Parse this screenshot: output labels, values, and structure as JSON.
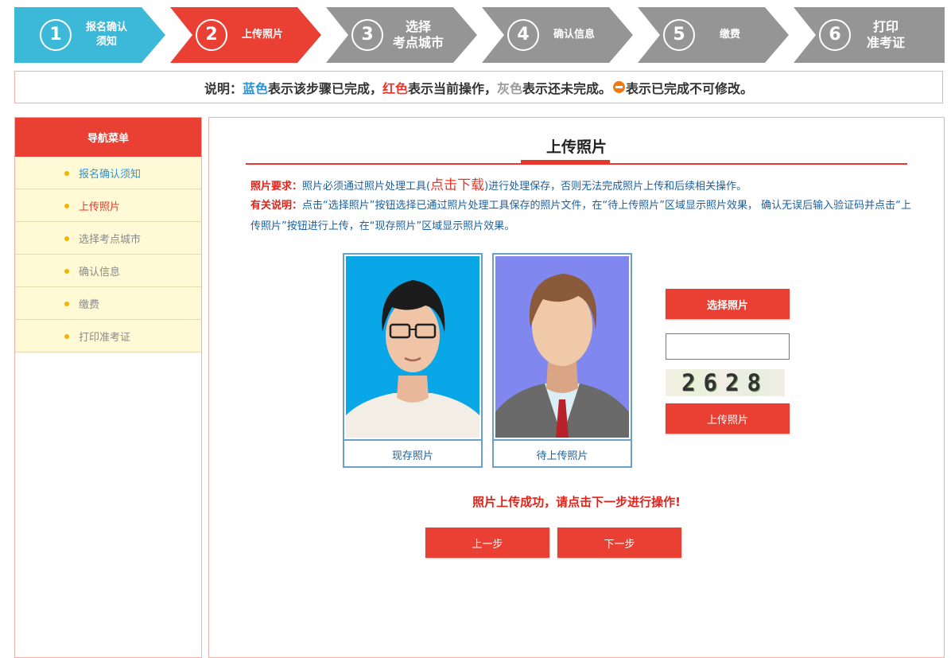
{
  "steps": [
    {
      "num": "1",
      "label": "报名确认\n须知",
      "status": "done",
      "color": "#3cb8d8"
    },
    {
      "num": "2",
      "label": "上传照片",
      "status": "current",
      "color": "#ea3f33"
    },
    {
      "num": "3",
      "label": "选择\n考点城市",
      "status": "todo",
      "color": "#959595"
    },
    {
      "num": "4",
      "label": "确认信息",
      "status": "todo",
      "color": "#959595"
    },
    {
      "num": "5",
      "label": "缴费",
      "status": "todo",
      "color": "#959595"
    },
    {
      "num": "6",
      "label": "打印\n准考证",
      "status": "todo",
      "color": "#959595"
    }
  ],
  "legend": {
    "prefix": "说明：",
    "blue_word": "蓝色",
    "blue_text": "表示该步骤已完成，",
    "red_word": "红色",
    "red_text": "表示当前操作，",
    "gray_word": "灰色",
    "gray_text": "表示还未完成。",
    "lock_text": "表示已完成不可修改。"
  },
  "sidebar": {
    "title": "导航菜单",
    "items": [
      {
        "label": "报名确认须知",
        "status": "done"
      },
      {
        "label": "上传照片",
        "status": "current"
      },
      {
        "label": "选择考点城市",
        "status": "todo"
      },
      {
        "label": "确认信息",
        "status": "todo"
      },
      {
        "label": "缴费",
        "status": "todo"
      },
      {
        "label": "打印准考证",
        "status": "todo"
      }
    ]
  },
  "main": {
    "title": "上传照片",
    "req_label": "照片要求：",
    "req_text1": "照片必须通过照片处理工具(",
    "req_link": "点击下载",
    "req_text2": ")进行处理保存，否则无法完成照片上传和后续相关操作。",
    "note_label": "有关说明：",
    "note_text": "点击“选择照片”按钮选择已通过照片处理工具保存的照片文件，在“待上传照片”区域显示照片效果， 确认无误后输入验证码并点击“上传照片”按钮进行上传，在“现存照片”区域显示照片效果。",
    "current_photo_caption": "现存照片",
    "pending_photo_caption": "待上传照片",
    "select_button": "选择照片",
    "captcha_value": "",
    "captcha_text": "2628",
    "upload_button": "上传照片",
    "success_message": "照片上传成功，请点击下一步进行操作!",
    "prev_button": "上一步",
    "next_button": "下一步"
  },
  "colors": {
    "accent_red": "#ea3f33",
    "done_blue": "#3cb8d8",
    "todo_gray": "#959595",
    "link_blue": "#1d5f9e"
  }
}
